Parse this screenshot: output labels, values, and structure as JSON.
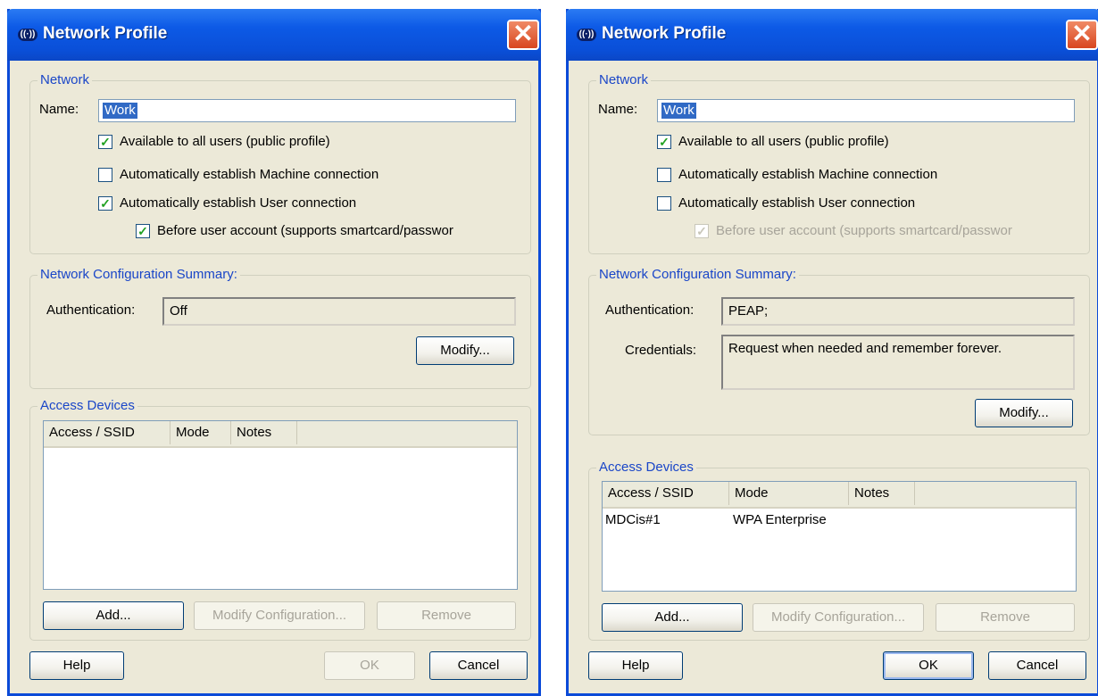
{
  "left": {
    "title": "Network Profile",
    "close_glyph": "✕",
    "network": {
      "legend": "Network",
      "name_label": "Name:",
      "name_value": "Work",
      "checkboxes": [
        {
          "label": "Available to all users (public profile)",
          "checked": true,
          "enabled": true
        },
        {
          "label": "Automatically establish Machine connection",
          "checked": false,
          "enabled": true
        },
        {
          "label": "Automatically establish User connection",
          "checked": true,
          "enabled": true
        },
        {
          "label": "Before user account (supports smartcard/passwor",
          "checked": true,
          "enabled": true
        }
      ]
    },
    "summary": {
      "legend": "Network Configuration Summary:",
      "auth_label": "Authentication:",
      "auth_value": "Off",
      "modify_label": "Modify..."
    },
    "access": {
      "legend": "Access Devices",
      "columns": [
        "Access / SSID",
        "Mode",
        "Notes"
      ],
      "rows": [],
      "add_label": "Add...",
      "modify_config_label": "Modify Configuration...",
      "remove_label": "Remove"
    },
    "footer": {
      "help_label": "Help",
      "ok_label": "OK",
      "cancel_label": "Cancel"
    }
  },
  "right": {
    "title": "Network Profile",
    "close_glyph": "✕",
    "network": {
      "legend": "Network",
      "name_label": "Name:",
      "name_value": "Work",
      "checkboxes": [
        {
          "label": "Available to all users (public profile)",
          "checked": true,
          "enabled": true
        },
        {
          "label": "Automatically establish Machine connection",
          "checked": false,
          "enabled": true
        },
        {
          "label": "Automatically establish User connection",
          "checked": false,
          "enabled": true
        },
        {
          "label": "Before user account (supports smartcard/passwor",
          "checked": true,
          "enabled": false
        }
      ]
    },
    "summary": {
      "legend": "Network Configuration Summary:",
      "auth_label": "Authentication:",
      "auth_value": "PEAP;",
      "cred_label": "Credentials:",
      "cred_value": "Request when needed and remember forever.",
      "modify_label": "Modify..."
    },
    "access": {
      "legend": "Access Devices",
      "columns": [
        "Access / SSID",
        "Mode",
        "Notes"
      ],
      "rows": [
        {
          "ssid": "MDCis#1",
          "mode": "WPA Enterprise",
          "notes": ""
        }
      ],
      "add_label": "Add...",
      "modify_config_label": "Modify Configuration...",
      "remove_label": "Remove"
    },
    "footer": {
      "help_label": "Help",
      "ok_label": "OK",
      "cancel_label": "Cancel"
    }
  }
}
